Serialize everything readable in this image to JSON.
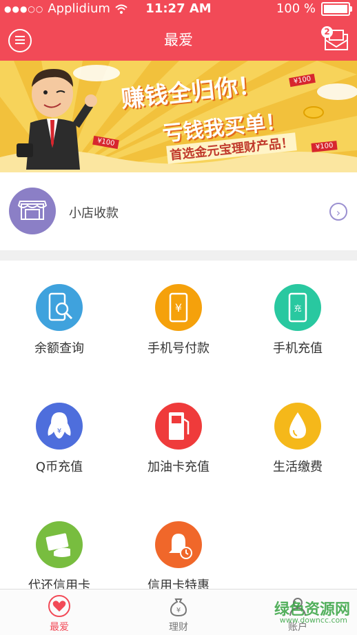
{
  "status": {
    "carrier": "Applidium",
    "time": "11:27 AM",
    "battery": "100 %",
    "battery_level": 1.0
  },
  "header": {
    "title": "最爱",
    "badge": "2"
  },
  "banner": {
    "line1": "赚钱全归你！",
    "line2": "亏钱我买单！",
    "line3": "首选金元宝理财产品！",
    "tag1": "¥100",
    "tag2": "¥100",
    "tag3": "¥100"
  },
  "shop": {
    "label": "小店收款"
  },
  "services": [
    {
      "label": "余额查询",
      "color": "#3fa2dd",
      "icon": "search-phone-icon"
    },
    {
      "label": "手机号付款",
      "color": "#f5a10b",
      "icon": "yuan-phone-icon"
    },
    {
      "label": "手机充值",
      "color": "#29c8a0",
      "icon": "charge-phone-icon",
      "glyph": "充"
    },
    {
      "label": "Q币充值",
      "color": "#4e6edc",
      "icon": "penguin-icon"
    },
    {
      "label": "加油卡充值",
      "color": "#ef3b3b",
      "icon": "fuel-pump-icon"
    },
    {
      "label": "生活缴费",
      "color": "#f5b81a",
      "icon": "water-drop-icon"
    },
    {
      "label": "代还信用卡",
      "color": "#78bd3f",
      "icon": "card-hand-icon"
    },
    {
      "label": "信用卡特惠",
      "color": "#f0672a",
      "icon": "bell-clock-icon"
    }
  ],
  "tabs": [
    {
      "label": "最爱",
      "active": true,
      "icon": "heart-icon"
    },
    {
      "label": "理财",
      "active": false,
      "icon": "money-bag-icon"
    },
    {
      "label": "账户",
      "active": false,
      "icon": "user-icon"
    }
  ],
  "watermark": {
    "text": "绿色资源网",
    "url": "www.downcc.com"
  },
  "colors": {
    "primary": "#f24a57",
    "banner_bg": "#f2c13c",
    "shop_icon": "#8b7fc6"
  }
}
